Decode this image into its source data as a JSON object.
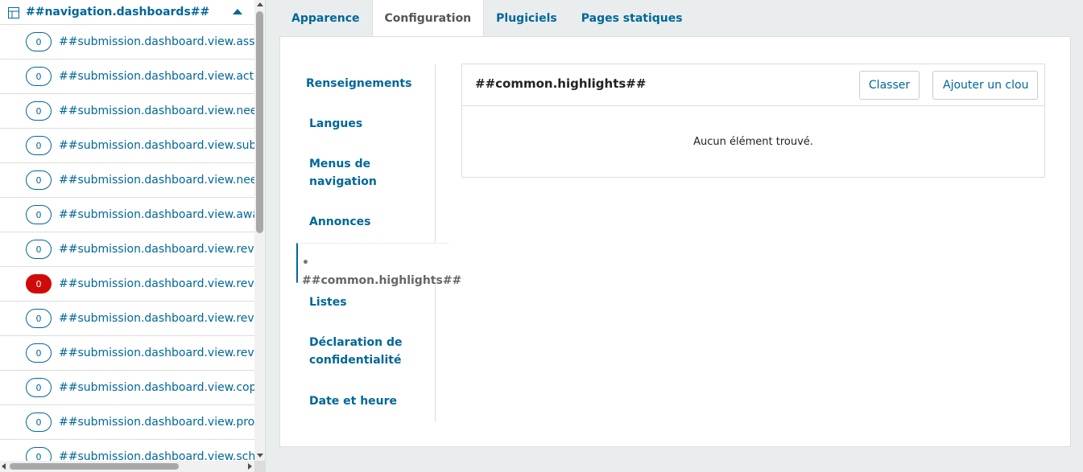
{
  "sidebar": {
    "title": "##navigation.dashboards##",
    "items": [
      {
        "count": "0",
        "label": "##submission.dashboard.view.assig",
        "urgent": false
      },
      {
        "count": "0",
        "label": "##submission.dashboard.view.active",
        "urgent": false
      },
      {
        "count": "0",
        "label": "##submission.dashboard.view.needs",
        "urgent": false
      },
      {
        "count": "0",
        "label": "##submission.dashboard.view.subm",
        "urgent": false
      },
      {
        "count": "0",
        "label": "##submission.dashboard.view.needs",
        "urgent": false
      },
      {
        "count": "0",
        "label": "##submission.dashboard.view.await",
        "urgent": false
      },
      {
        "count": "0",
        "label": "##submission.dashboard.view.review",
        "urgent": false
      },
      {
        "count": "0",
        "label": "##submission.dashboard.view.review",
        "urgent": true
      },
      {
        "count": "0",
        "label": "##submission.dashboard.view.revisi",
        "urgent": false
      },
      {
        "count": "0",
        "label": "##submission.dashboard.view.review",
        "urgent": false
      },
      {
        "count": "0",
        "label": "##submission.dashboard.view.copye",
        "urgent": false
      },
      {
        "count": "0",
        "label": "##submission.dashboard.view.produ",
        "urgent": false
      },
      {
        "count": "0",
        "label": "##submission.dashboard.view.sched",
        "urgent": false
      }
    ]
  },
  "tabs": [
    {
      "label": "Apparence",
      "active": false
    },
    {
      "label": "Configuration",
      "active": true
    },
    {
      "label": "Plugiciels",
      "active": false
    },
    {
      "label": "Pages statiques",
      "active": false
    }
  ],
  "subnav": [
    {
      "label": "Renseignements",
      "active": false
    },
    {
      "label": "Langues",
      "active": false
    },
    {
      "label": "Menus de navigation",
      "active": false
    },
    {
      "label": "Annonces",
      "active": false
    },
    {
      "label": "##common.highlights##",
      "active": true
    },
    {
      "label": "Listes",
      "active": false
    },
    {
      "label": "Déclaration de confidentialité",
      "active": false
    },
    {
      "label": "Date et heure",
      "active": false
    }
  ],
  "highlights": {
    "title": "##common.highlights##",
    "sort_label": "Classer",
    "add_label": "Ajouter un clou",
    "empty_message": "Aucun élément trouvé."
  },
  "colors": {
    "primary": "#006798",
    "urgent": "#d00a0a"
  }
}
